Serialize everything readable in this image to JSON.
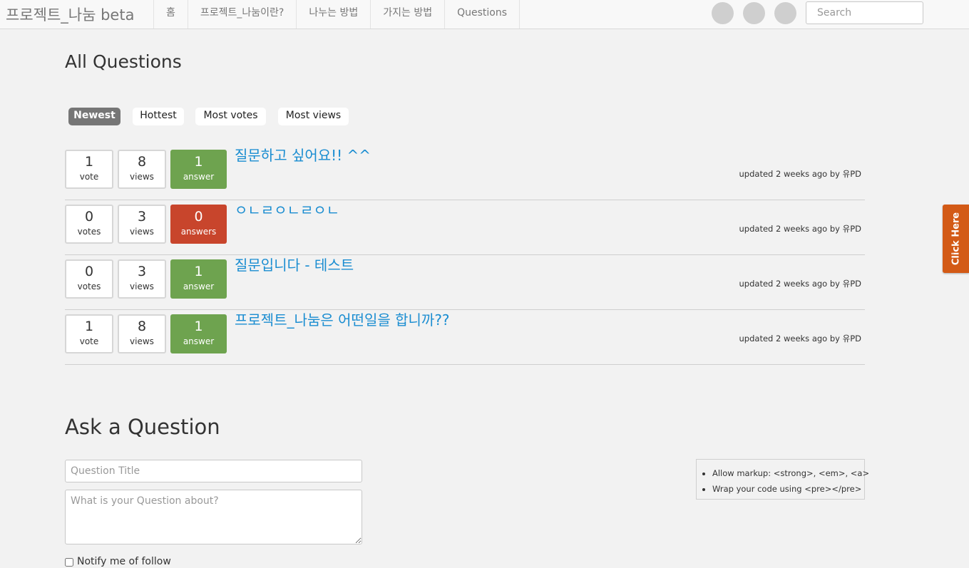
{
  "navbar": {
    "brand": "프로젝트_나눔 beta",
    "links": [
      "홈",
      "프로젝트_나눔이란?",
      "나누는 방법",
      "가지는 방법",
      "Questions"
    ],
    "search_placeholder": "Search"
  },
  "page_title": "All Questions",
  "sort_tabs": [
    "Newest",
    "Hottest",
    "Most votes",
    "Most views"
  ],
  "active_sort": "Newest",
  "questions": [
    {
      "votes": "1",
      "votes_label": "vote",
      "views": "8",
      "views_label": "views",
      "answers": "1",
      "answers_label": "answer",
      "title": "질문하고 싶어요!! ^^",
      "meta": "updated 2 weeks ago by 유PD"
    },
    {
      "votes": "0",
      "votes_label": "votes",
      "views": "3",
      "views_label": "views",
      "answers": "0",
      "answers_label": "answers",
      "title": "ㅇㄴㄹㅇㄴㄹㅇㄴ",
      "meta": "updated 2 weeks ago by 유PD"
    },
    {
      "votes": "0",
      "votes_label": "votes",
      "views": "3",
      "views_label": "views",
      "answers": "1",
      "answers_label": "answer",
      "title": "질문입니다 - 테스트",
      "meta": "updated 2 weeks ago by 유PD"
    },
    {
      "votes": "1",
      "votes_label": "vote",
      "views": "8",
      "views_label": "views",
      "answers": "1",
      "answers_label": "answer",
      "title": "프로젝트_나눔은 어떤일을 합니까??",
      "meta": "updated 2 weeks ago by 유PD"
    }
  ],
  "ask": {
    "heading": "Ask a Question",
    "title_placeholder": "Question Title",
    "body_placeholder": "What is your Question about?",
    "notify_label": "Notify me of follow",
    "help": [
      "Allow markup: <strong>, <em>, <a>",
      "Wrap your code using <pre></pre>"
    ]
  },
  "side_tab": "Click Here",
  "colors": {
    "answered": "#6ea34f",
    "unanswered": "#c8452c",
    "link": "#1a8dd1",
    "side_tab": "#d35a16",
    "active_pill": "#767676"
  }
}
